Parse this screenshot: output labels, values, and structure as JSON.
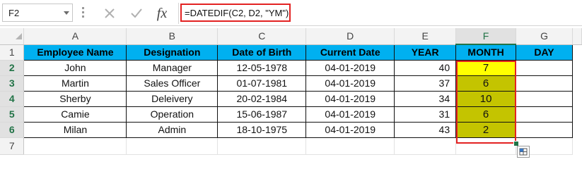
{
  "formula_bar": {
    "name_box": "F2",
    "formula": "=DATEDIF(C2, D2, \"YM\")",
    "fx_label": "fx",
    "cancel_icon": "close-icon",
    "enter_icon": "check-icon"
  },
  "columns": [
    "A",
    "B",
    "C",
    "D",
    "E",
    "F",
    "G"
  ],
  "selected_column": "F",
  "rows": [
    "1",
    "2",
    "3",
    "4",
    "5",
    "6",
    "7"
  ],
  "header": [
    "Employee Name",
    "Designation",
    "Date of Birth",
    "Current Date",
    "YEAR",
    "MONTH",
    "DAY"
  ],
  "data": [
    {
      "name": "John",
      "designation": "Manager",
      "dob": "12-05-1978",
      "current": "04-01-2019",
      "year": "40",
      "month": "7",
      "day": ""
    },
    {
      "name": "Martin",
      "designation": "Sales Officer",
      "dob": "01-07-1981",
      "current": "04-01-2019",
      "year": "37",
      "month": "6",
      "day": ""
    },
    {
      "name": "Sherby",
      "designation": "Deleivery",
      "dob": "20-02-1984",
      "current": "04-01-2019",
      "year": "34",
      "month": "10",
      "day": ""
    },
    {
      "name": "Camie",
      "designation": "Operation",
      "dob": "15-06-1987",
      "current": "04-01-2019",
      "year": "31",
      "month": "6",
      "day": ""
    },
    {
      "name": "Milan",
      "designation": "Admin",
      "dob": "18-10-1975",
      "current": "04-01-2019",
      "year": "43",
      "month": "2",
      "day": ""
    }
  ],
  "colors": {
    "header_fill": "#00b0f0",
    "active_cell_fill": "#ffff00",
    "month_fill": "#c4c400",
    "selection_border": "#e32222",
    "excel_green": "#217346"
  }
}
